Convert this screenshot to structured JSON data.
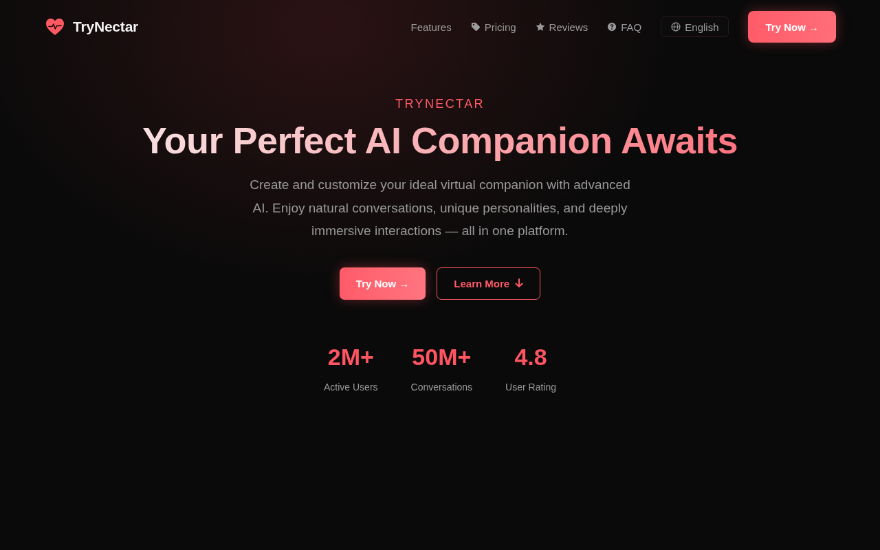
{
  "brand": {
    "name": "TryNectar"
  },
  "nav": {
    "links": [
      {
        "label": "Features"
      },
      {
        "label": "Pricing"
      },
      {
        "label": "Reviews"
      },
      {
        "label": "FAQ"
      }
    ],
    "language": {
      "label": "English"
    },
    "cta": {
      "label": "Try Now →"
    }
  },
  "hero": {
    "eyebrow": "TRYNECTAR",
    "title": "Your Perfect AI Companion Awaits",
    "description": "Create and customize your ideal virtual companion with advanced AI. Enjoy natural conversations, unique personalities, and deeply immersive interactions — all in one platform.",
    "buttons": [
      {
        "label": "Try Now →",
        "kind": "primary"
      },
      {
        "label": "Learn More",
        "kind": "outline"
      }
    ],
    "stats": [
      {
        "value": "2M+",
        "label": "Active Users"
      },
      {
        "value": "50M+",
        "label": "Conversations"
      },
      {
        "value": "4.8",
        "label": "User Rating"
      }
    ]
  }
}
